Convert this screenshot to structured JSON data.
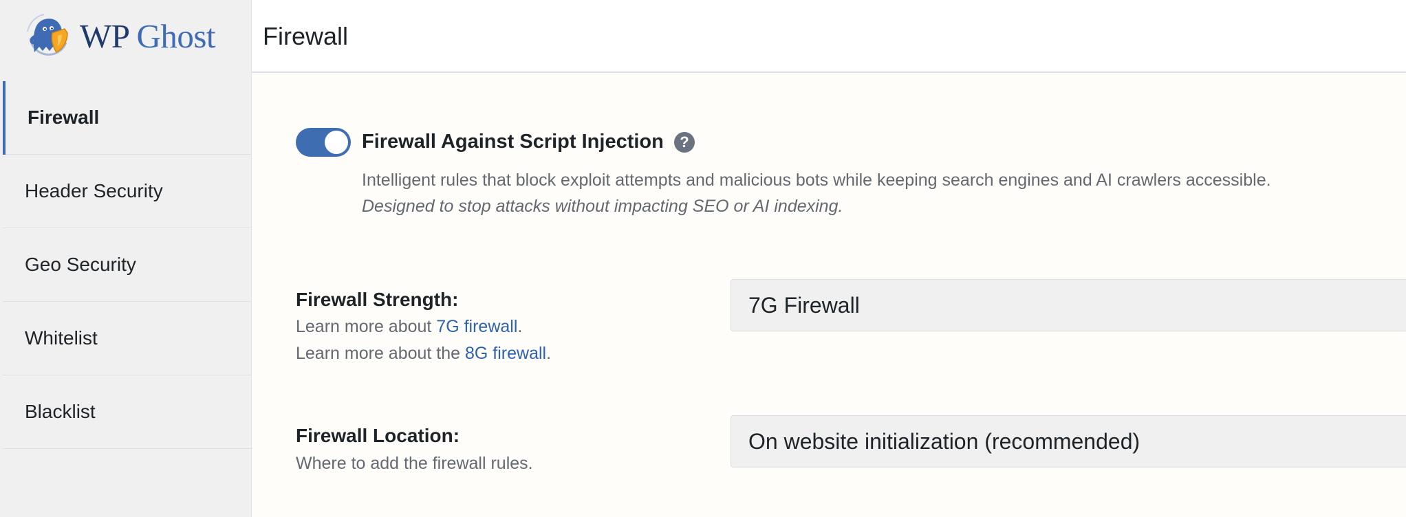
{
  "brand": {
    "logo_wp": "WP",
    "logo_ghost": "Ghost",
    "mascot_icon": "ghost-mascot-icon"
  },
  "header": {
    "title": "Firewall"
  },
  "sidebar": {
    "items": [
      {
        "label": "Firewall",
        "active": true
      },
      {
        "label": "Header Security",
        "active": false
      },
      {
        "label": "Geo Security",
        "active": false
      },
      {
        "label": "Whitelist",
        "active": false
      },
      {
        "label": "Blacklist",
        "active": false
      }
    ]
  },
  "feature": {
    "title": "Firewall Against Script Injection",
    "enabled": true,
    "help_icon": "?",
    "description": "Intelligent rules that block exploit attempts and malicious bots while keeping search engines and AI crawlers accessible.",
    "note": "Designed to stop attacks without impacting SEO or AI indexing."
  },
  "strength": {
    "label": "Firewall Strength:",
    "help_prefix_1": "Learn more about ",
    "link_1": "7G firewall",
    "help_suffix_1": ".",
    "help_prefix_2": "Learn more about the ",
    "link_2": "8G firewall",
    "help_suffix_2": ".",
    "selected": "7G Firewall"
  },
  "location": {
    "label": "Firewall Location:",
    "help": "Where to add the firewall rules.",
    "selected": "On website initialization (recommended)"
  },
  "colors": {
    "accent": "#3f6db1",
    "link": "#2e62b1",
    "sidebar_bg": "#f0f0f1",
    "muted_text": "#646970"
  }
}
